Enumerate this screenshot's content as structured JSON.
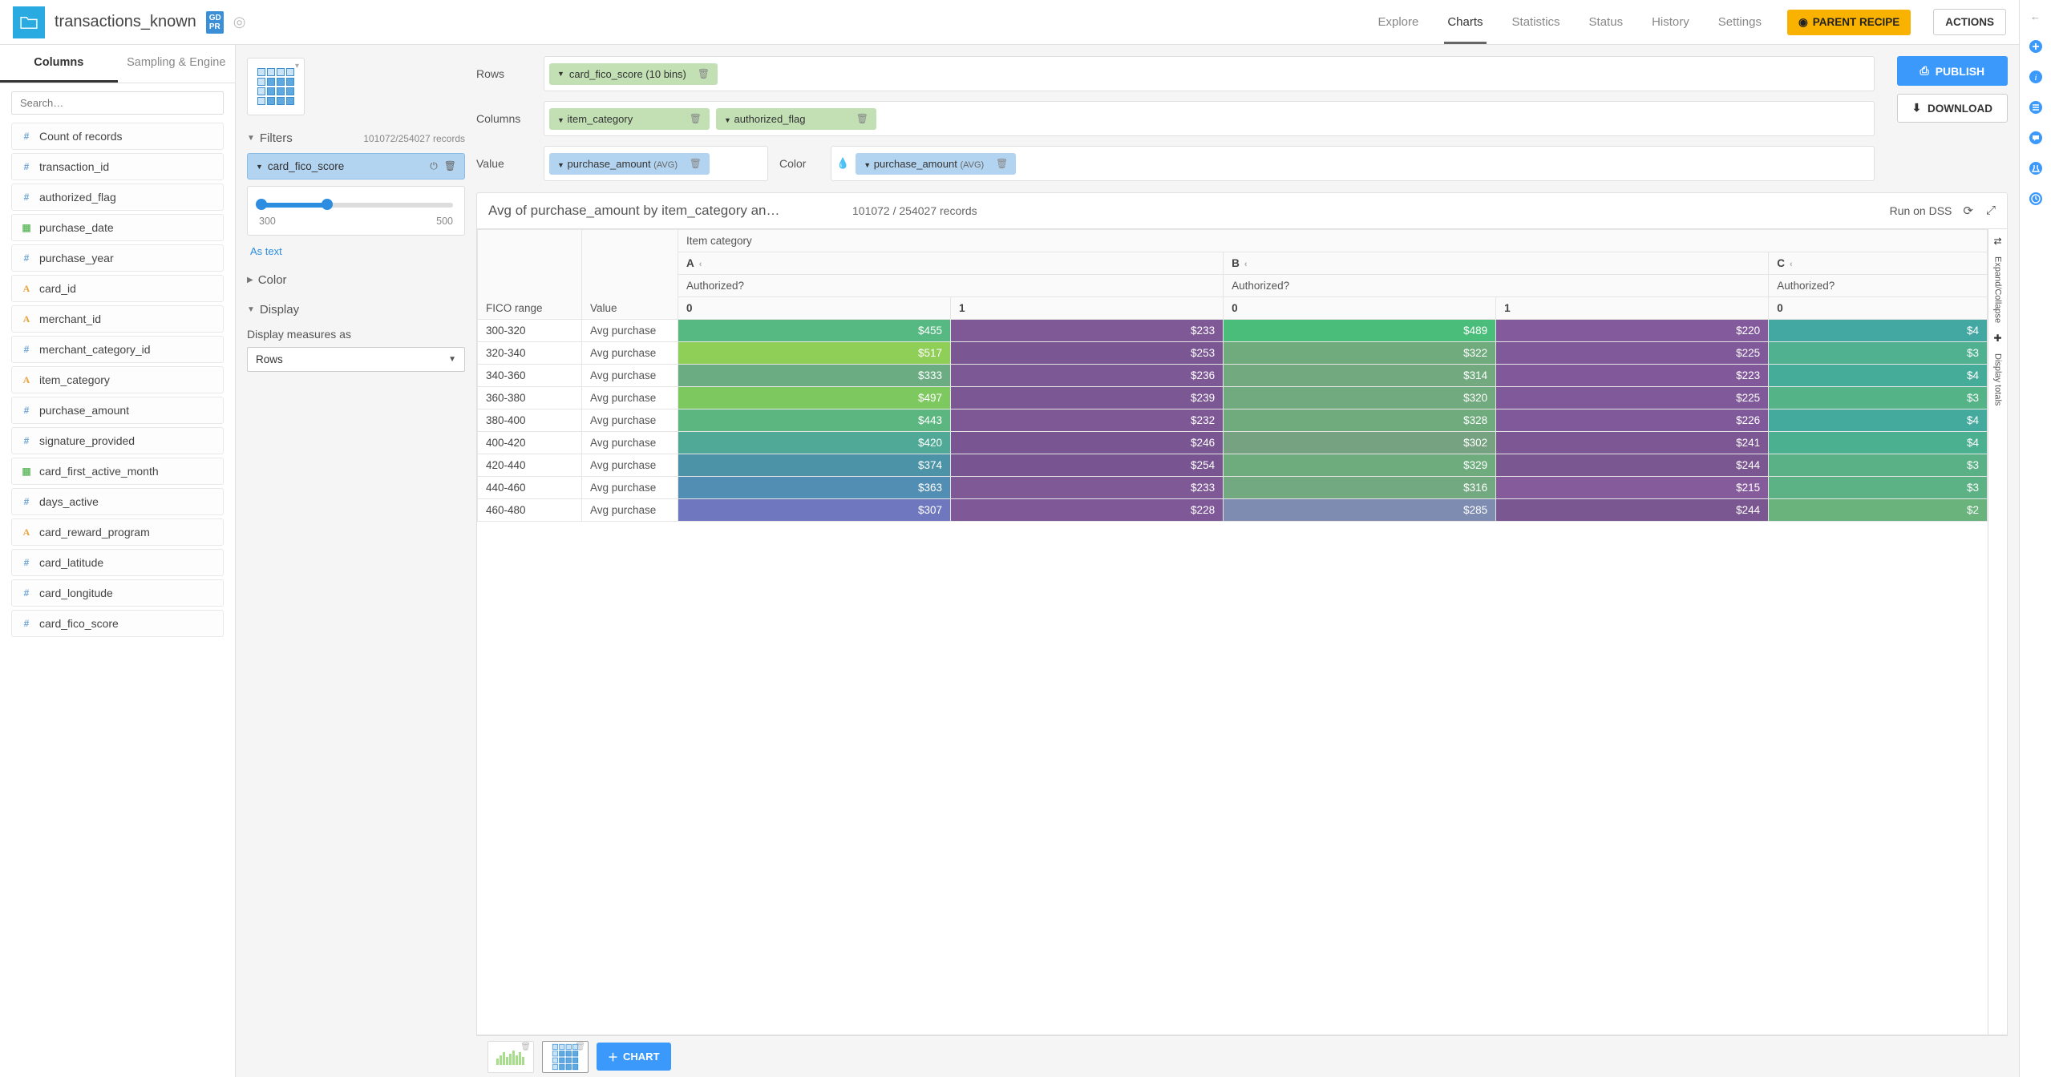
{
  "dataset_name": "transactions_known",
  "gdpr_badge": "GD\nPR",
  "top_tabs": [
    "Explore",
    "Charts",
    "Statistics",
    "Status",
    "History",
    "Settings"
  ],
  "top_active_tab": 1,
  "parent_recipe_label": "PARENT RECIPE",
  "actions_label": "ACTIONS",
  "sidebar_tabs": [
    "Columns",
    "Sampling & Engine"
  ],
  "sidebar_active": 0,
  "search_placeholder": "Search…",
  "columns": [
    {
      "type": "hash",
      "name": "Count of records"
    },
    {
      "type": "hash",
      "name": "transaction_id"
    },
    {
      "type": "hash",
      "name": "authorized_flag"
    },
    {
      "type": "date",
      "name": "purchase_date"
    },
    {
      "type": "hash",
      "name": "purchase_year"
    },
    {
      "type": "text",
      "name": "card_id"
    },
    {
      "type": "text",
      "name": "merchant_id"
    },
    {
      "type": "hash",
      "name": "merchant_category_id"
    },
    {
      "type": "text",
      "name": "item_category"
    },
    {
      "type": "hash",
      "name": "purchase_amount"
    },
    {
      "type": "hash",
      "name": "signature_provided"
    },
    {
      "type": "date",
      "name": "card_first_active_month"
    },
    {
      "type": "hash",
      "name": "days_active"
    },
    {
      "type": "text",
      "name": "card_reward_program"
    },
    {
      "type": "hash",
      "name": "card_latitude"
    },
    {
      "type": "hash",
      "name": "card_longitude"
    },
    {
      "type": "hash",
      "name": "card_fico_score"
    }
  ],
  "filters_label": "Filters",
  "filter_count": "101072/254027 records",
  "filter_chip": "card_fico_score",
  "slider_min": "300",
  "slider_max": "500",
  "as_text": "As text",
  "color_section": "Color",
  "display_section": "Display",
  "display_measures_label": "Display measures as",
  "display_measures_value": "Rows",
  "config": {
    "rows_label": "Rows",
    "rows_chip": "card_fico_score (10 bins)",
    "columns_label": "Columns",
    "columns_chips": [
      "item_category",
      "authorized_flag"
    ],
    "value_label": "Value",
    "value_chip": "purchase_amount",
    "value_agg": "(AVG)",
    "color_label": "Color",
    "color_chip": "purchase_amount",
    "color_agg": "(AVG)"
  },
  "publish_label": "PUBLISH",
  "download_label": "DOWNLOAD",
  "chart_header": {
    "title": "Avg of purchase_amount by item_category an…",
    "records": "101072 / 254027 records",
    "run_on": "Run on DSS"
  },
  "pivot_labels": {
    "item_category": "Item category",
    "authorized": "Authorized?",
    "fico": "FICO range",
    "value": "Value",
    "val_name": "Avg purchase",
    "expand": "Expand/Collapse",
    "totals": "Display totals"
  },
  "chart_data": {
    "type": "table",
    "title": "Avg of purchase_amount by item_category and authorized_flag",
    "row_dimension": "FICO range",
    "measure": "Avg purchase",
    "columns": [
      {
        "item_category": "A",
        "authorized": "0"
      },
      {
        "item_category": "A",
        "authorized": "1"
      },
      {
        "item_category": "B",
        "authorized": "0"
      },
      {
        "item_category": "B",
        "authorized": "1"
      },
      {
        "item_category": "C",
        "authorized": "0"
      }
    ],
    "rows": [
      "300-320",
      "320-340",
      "340-360",
      "360-380",
      "380-400",
      "400-420",
      "420-440",
      "440-460",
      "460-480"
    ],
    "values": [
      [
        455,
        233,
        489,
        220,
        4
      ],
      [
        517,
        253,
        322,
        225,
        3
      ],
      [
        333,
        236,
        314,
        223,
        4
      ],
      [
        497,
        239,
        320,
        225,
        3
      ],
      [
        443,
        232,
        328,
        226,
        4
      ],
      [
        420,
        246,
        302,
        241,
        4
      ],
      [
        374,
        254,
        329,
        244,
        3
      ],
      [
        363,
        233,
        316,
        215,
        3
      ],
      [
        307,
        228,
        285,
        244,
        2
      ]
    ],
    "cell_colors": [
      [
        "#55b981",
        "#7e5996",
        "#4bbd7a",
        "#835a9b",
        "#42a8a1"
      ],
      [
        "#8fce57",
        "#7a5793",
        "#70ab7d",
        "#80599a",
        "#4fb190"
      ],
      [
        "#6cac82",
        "#7c5894",
        "#73a97f",
        "#81599a",
        "#46ac9a"
      ],
      [
        "#7ec95f",
        "#7b5894",
        "#71aa7e",
        "#80599a",
        "#55b388"
      ],
      [
        "#5bb680",
        "#7d5895",
        "#6fab7d",
        "#80599a",
        "#44aa9d"
      ],
      [
        "#4fa996",
        "#795692",
        "#76a282",
        "#7c5793",
        "#4ab08f"
      ],
      [
        "#4c93a8",
        "#785591",
        "#6eac7d",
        "#7b5792",
        "#59b185"
      ],
      [
        "#528db3",
        "#7e5995",
        "#72a980",
        "#855b9c",
        "#5cb284"
      ],
      [
        "#6f78be",
        "#7f5997",
        "#7d8cb0",
        "#7b5792",
        "#6ab37d"
      ]
    ]
  },
  "add_chart_label": "CHART"
}
